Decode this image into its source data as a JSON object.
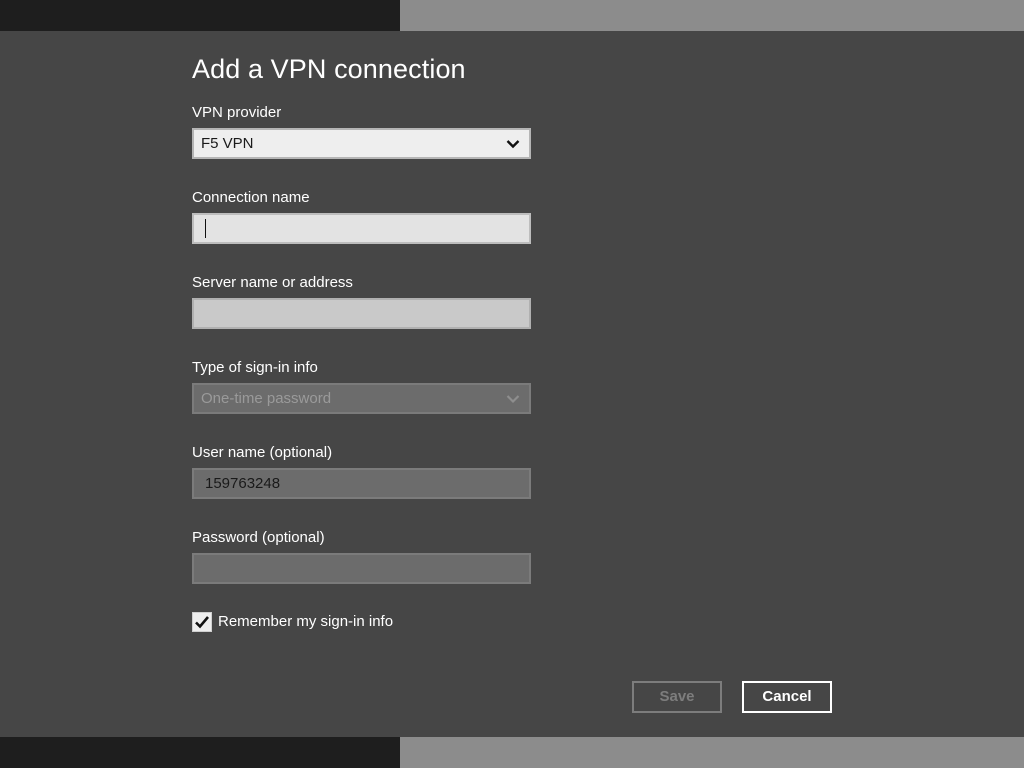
{
  "dialog": {
    "title": "Add a VPN connection"
  },
  "fields": {
    "vpn_provider": {
      "label": "VPN provider",
      "value": "F5 VPN"
    },
    "connection_name": {
      "label": "Connection name",
      "value": ""
    },
    "server_name": {
      "label": "Server name or address",
      "value": ""
    },
    "signin_type": {
      "label": "Type of sign-in info",
      "value": "One-time password"
    },
    "user_name": {
      "label": "User name (optional)",
      "value": "159763248"
    },
    "password": {
      "label": "Password (optional)",
      "value": ""
    }
  },
  "remember": {
    "label": "Remember my sign-in info",
    "checked": true
  },
  "buttons": {
    "save": "Save",
    "cancel": "Cancel"
  },
  "icons": {
    "dropdown": "chevron-down-icon",
    "check": "checkmark-icon"
  },
  "colors": {
    "background": "#464646",
    "field_light": "#e6e6e6",
    "field_disabled": "#6c6c6c",
    "text": "#ffffff"
  }
}
